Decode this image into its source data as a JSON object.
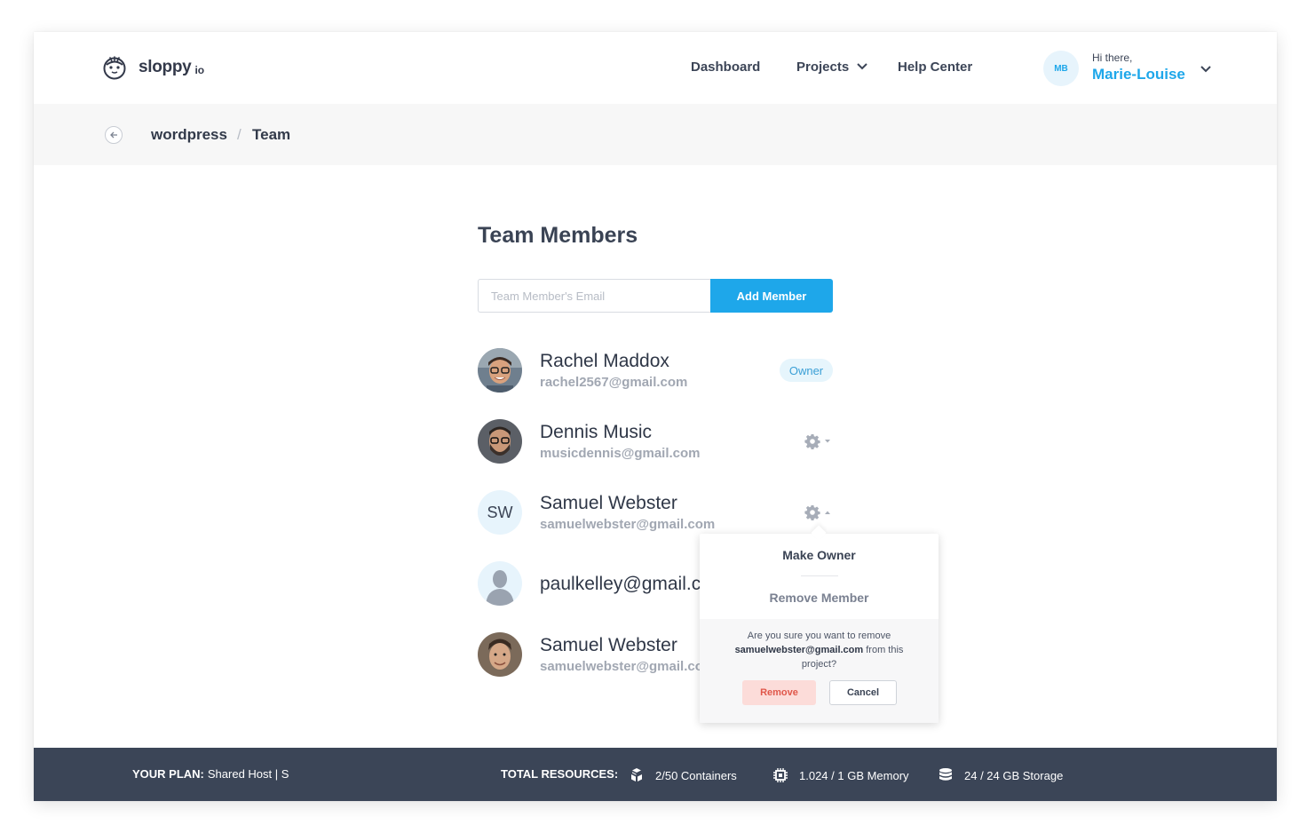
{
  "brand": {
    "name": "sloppy",
    "suffix": "io"
  },
  "nav": {
    "dashboard": "Dashboard",
    "projects": "Projects",
    "help": "Help Center",
    "user_initials": "MB",
    "greeting": "Hi there,",
    "user_name": "Marie-Louise"
  },
  "breadcrumb": {
    "project": "wordpress",
    "separator": "/",
    "current": "Team"
  },
  "main": {
    "title": "Team Members",
    "email_placeholder": "Team Member's Email",
    "add_button": "Add Member"
  },
  "members": [
    {
      "name": "Rachel Maddox",
      "email": "rachel2567@gmail.com",
      "badge": "Owner",
      "avatar": "photo"
    },
    {
      "name": "Dennis Music",
      "email": "musicdennis@gmail.com",
      "avatar": "photo"
    },
    {
      "name": "Samuel Webster",
      "email": "samuelwebster@gmail.com",
      "initials": "SW",
      "avatar": "initials"
    },
    {
      "name": "paulkelley@gmail.c",
      "avatar": "placeholder"
    },
    {
      "name": "Samuel Webster",
      "email": "samuelwebster@gmail.co",
      "avatar": "photo"
    }
  ],
  "popover": {
    "make_owner": "Make Owner",
    "remove_member": "Remove Member",
    "confirm_pre": "Are you sure you want to remove",
    "confirm_email": "samuelwebster@gmail.com",
    "confirm_post": "from this project?",
    "remove": "Remove",
    "cancel": "Cancel"
  },
  "footer": {
    "plan_label": "YOUR PLAN:",
    "plan_value": "Shared Host | S",
    "resources_label": "TOTAL RESOURCES:",
    "containers": "2/50 Containers",
    "memory": "1.024 / 1 GB Memory",
    "storage": "24 / 24 GB Storage"
  },
  "colors": {
    "accent": "#1ea7ea",
    "footer": "#3b4557",
    "danger": "#e0574a"
  }
}
